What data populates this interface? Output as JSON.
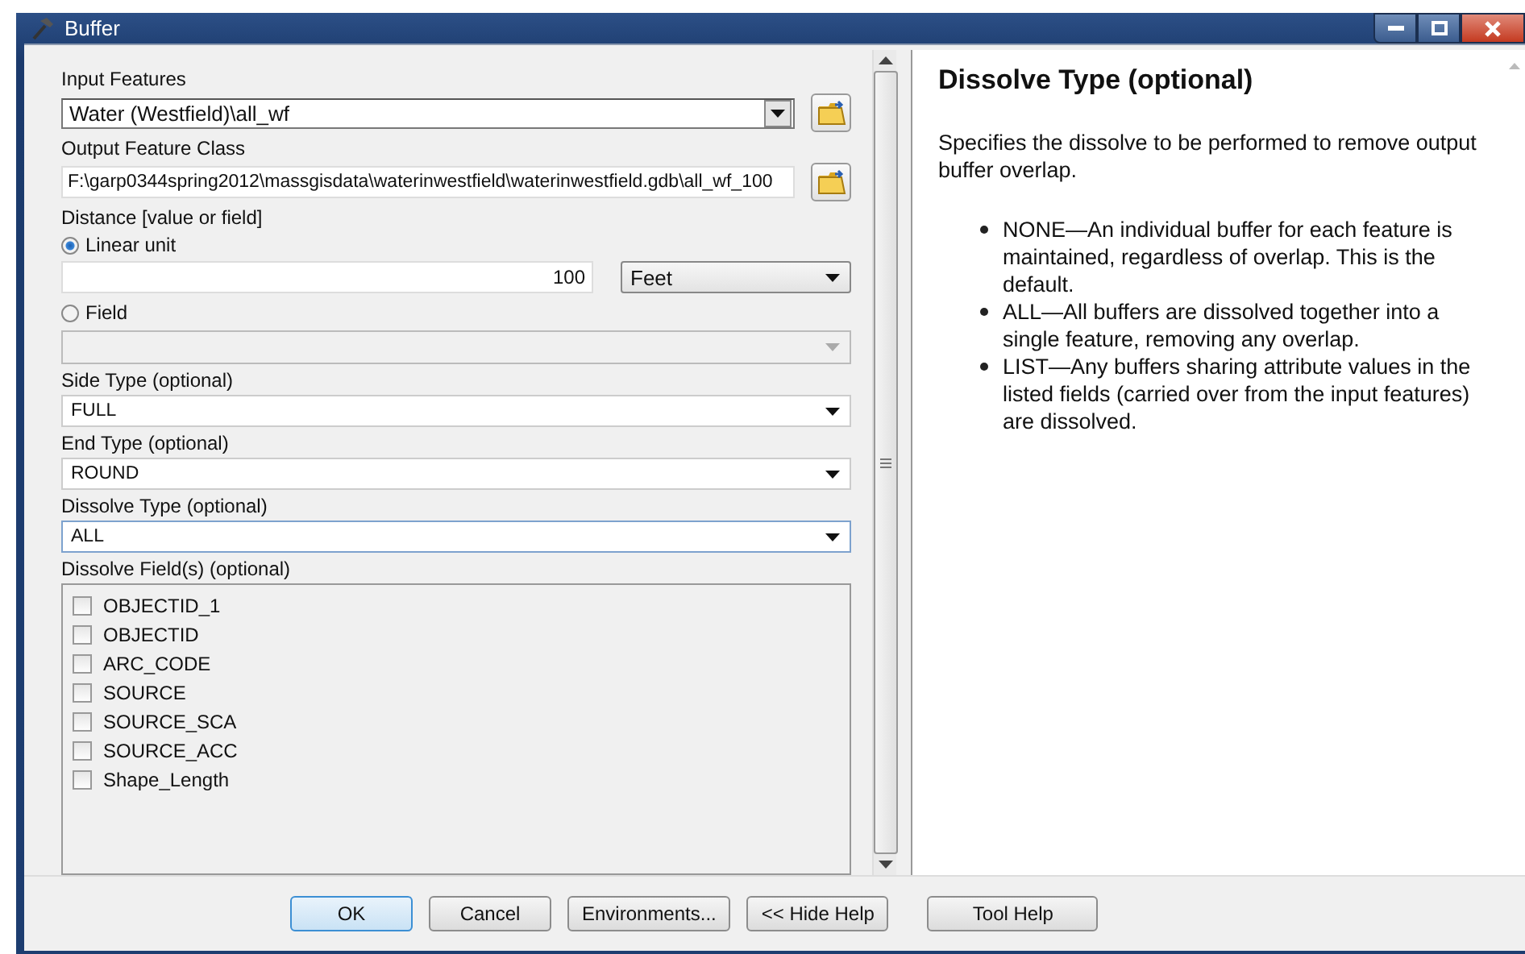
{
  "window": {
    "title": "Buffer"
  },
  "input_features": {
    "label": "Input Features",
    "value": "Water (Westfield)\\all_wf"
  },
  "output_feature_class": {
    "label": "Output Feature Class",
    "value": "F:\\garp0344spring2012\\massgisdata\\waterinwestfield\\waterinwestfield.gdb\\all_wf_100"
  },
  "distance": {
    "label": "Distance [value or field]",
    "options": [
      {
        "label": "Linear unit",
        "selected": true
      },
      {
        "label": "Field",
        "selected": false
      }
    ],
    "value": "100",
    "unit": "Feet",
    "field_combo": {
      "disabled": true
    }
  },
  "selects": [
    {
      "label": "Side Type (optional)",
      "value": "FULL",
      "focused": false
    },
    {
      "label": "End Type (optional)",
      "value": "ROUND",
      "focused": false
    },
    {
      "label": "Dissolve Type (optional)",
      "value": "ALL",
      "focused": true
    }
  ],
  "dissolve_fields": {
    "label": "Dissolve Field(s) (optional)",
    "items": [
      {
        "label": "OBJECTID_1",
        "checked": false
      },
      {
        "label": "OBJECTID",
        "checked": false
      },
      {
        "label": "ARC_CODE",
        "checked": false
      },
      {
        "label": "SOURCE",
        "checked": false
      },
      {
        "label": "SOURCE_SCA",
        "checked": false
      },
      {
        "label": "SOURCE_ACC",
        "checked": false
      },
      {
        "label": "Shape_Length",
        "checked": false
      }
    ]
  },
  "help": {
    "title": "Dissolve Type (optional)",
    "intro": "Specifies the dissolve to be performed to remove output buffer overlap.",
    "bullets": [
      "NONE—An individual buffer for each feature is maintained, regardless of overlap. This is the default.",
      "ALL—All buffers are dissolved together into a single feature, removing any overlap.",
      "LIST—Any buffers sharing attribute values in the listed fields (carried over from the input features) are dissolved."
    ]
  },
  "buttons": [
    {
      "label": "OK",
      "default": true
    },
    {
      "label": "Cancel",
      "default": false
    },
    {
      "label": "Environments...",
      "default": false
    },
    {
      "label": "<< Hide Help",
      "default": false
    },
    {
      "label": "Tool Help",
      "default": false,
      "kind": "separate"
    }
  ]
}
